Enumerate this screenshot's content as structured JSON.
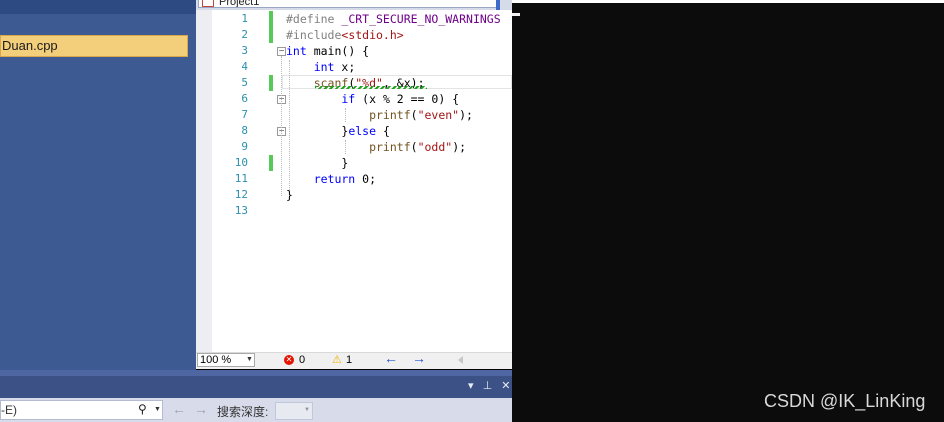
{
  "solution_explorer": {
    "file_name": "Duan.cpp"
  },
  "editor": {
    "tab_title": "Project1",
    "line_numbers": [
      "1",
      "2",
      "3",
      "4",
      "5",
      "6",
      "7",
      "8",
      "9",
      "10",
      "11",
      "12",
      "13"
    ],
    "lines": [
      [
        {
          "t": "#define ",
          "c": "pp"
        },
        {
          "t": "_CRT_SECURE_NO_WARNINGS",
          "c": "mac"
        }
      ],
      [
        {
          "t": "#include",
          "c": "pp"
        },
        {
          "t": "<stdio.h>",
          "c": "str"
        }
      ],
      [
        {
          "t": "int",
          "c": "kw"
        },
        {
          "t": " main() {",
          "c": ""
        }
      ],
      [
        {
          "t": "    int",
          "c": "kw"
        },
        {
          "t": " x;",
          "c": ""
        }
      ],
      [
        {
          "t": "    scanf",
          "c": "fn"
        },
        {
          "t": "(",
          "c": ""
        },
        {
          "t": "\"%d\"",
          "c": "str"
        },
        {
          "t": ", &x);",
          "c": ""
        }
      ],
      [
        {
          "t": "        if",
          "c": "kw"
        },
        {
          "t": " (x % 2 == 0) {",
          "c": ""
        }
      ],
      [
        {
          "t": "            printf",
          "c": "fn"
        },
        {
          "t": "(",
          "c": ""
        },
        {
          "t": "\"even\"",
          "c": "str"
        },
        {
          "t": ");",
          "c": ""
        }
      ],
      [
        {
          "t": "        }",
          "c": ""
        },
        {
          "t": "else",
          "c": "kw"
        },
        {
          "t": " {",
          "c": ""
        }
      ],
      [
        {
          "t": "            printf",
          "c": "fn"
        },
        {
          "t": "(",
          "c": ""
        },
        {
          "t": "\"odd\"",
          "c": "str"
        },
        {
          "t": ");",
          "c": ""
        }
      ],
      [
        {
          "t": "        }",
          "c": ""
        }
      ],
      [
        {
          "t": "    return",
          "c": "kw"
        },
        {
          "t": " 0;",
          "c": ""
        }
      ],
      [
        {
          "t": "}",
          "c": ""
        }
      ],
      []
    ]
  },
  "status_bar": {
    "zoom": "100 %",
    "errors": "0",
    "warnings": "1",
    "back_arrow": "←",
    "forward_arrow": "→"
  },
  "bottom_panel": {
    "pin_glyph": "▾ ᵖ ✕",
    "search_value": "-E)",
    "search_icon_glyph": "🔍",
    "search_depth_label": "搜索深度:"
  },
  "watermark": "CSDN @IK_LinKing"
}
